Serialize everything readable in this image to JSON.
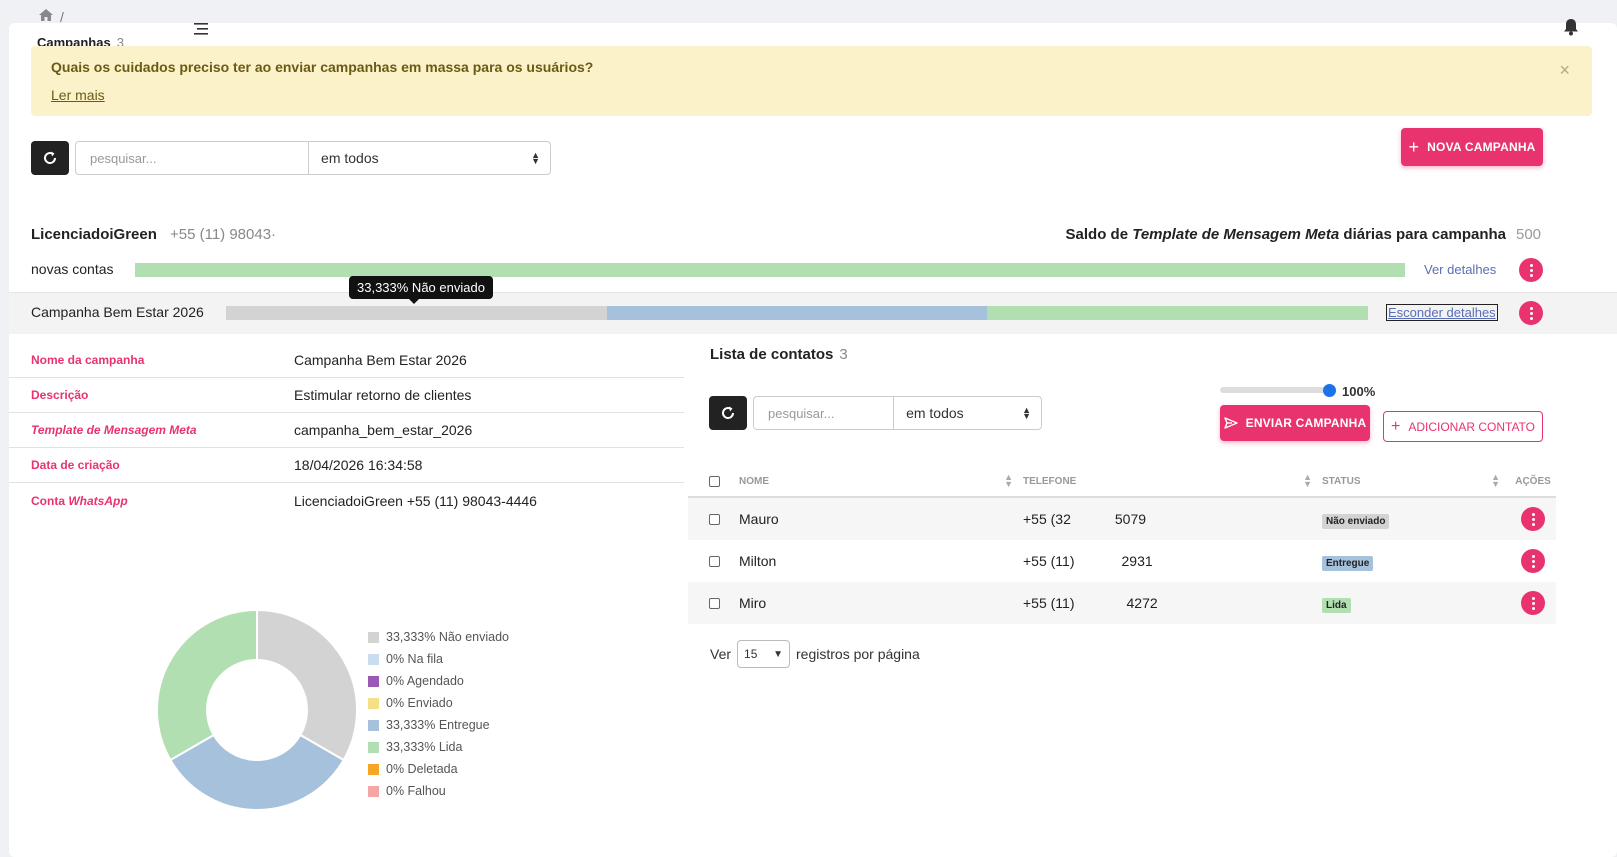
{
  "breadcrumb": {
    "separator": "/"
  },
  "page": {
    "title": "Campanhas",
    "count": "3"
  },
  "alert": {
    "question": "Quais os cuidados preciso ter ao enviar campanhas em massa para os usuários?",
    "link": "Ler mais",
    "close": "×"
  },
  "toolbar": {
    "search_placeholder": "pesquisar...",
    "filter_value": "em todos",
    "new_campaign": "NOVA CAMPANHA"
  },
  "account": {
    "name": "LicenciadoiGreen",
    "phone": "+55 (11) 98043·",
    "saldo_prefix": "Saldo de",
    "saldo_em": "Template de Mensagem Meta",
    "saldo_suffix": "diárias para campanha",
    "saldo_value": "500"
  },
  "groups": [
    {
      "label": "novas contas",
      "action": "Ver detalhes"
    },
    {
      "label": "Campanha Bem Estar 2026",
      "action": "Esconder detalhes",
      "tooltip": "33,333% Não enviado"
    }
  ],
  "details": [
    {
      "key": "Nome da campanha",
      "value": "Campanha Bem Estar 2026"
    },
    {
      "key": "Descrição",
      "value": "Estimular retorno de clientes"
    },
    {
      "key": "Template de Mensagem Meta",
      "value": "campanha_bem_estar_2026"
    },
    {
      "key": "Data de criação",
      "value": "18/04/2026 16:34:58"
    },
    {
      "key_prefix": "Conta",
      "key_em": "WhatsApp",
      "value": "LicenciadoiGreen +55 (11) 98043-4446"
    }
  ],
  "chart_data": {
    "type": "pie",
    "categories": [
      "Não enviado",
      "Na fila",
      "Agendado",
      "Enviado",
      "Entregue",
      "Lida",
      "Deletada",
      "Falhou"
    ],
    "values": [
      33.333,
      0,
      0,
      0,
      33.333,
      33.333,
      0,
      0
    ],
    "labels": [
      "33,333% Não enviado",
      "0% Na fila",
      "0% Agendado",
      "0% Enviado",
      "33,333% Entregue",
      "33,333% Lida",
      "0% Deletada",
      "0% Falhou"
    ],
    "colors": [
      "#d3d3d3",
      "#c9dcf0",
      "#9b59b6",
      "#f5e08a",
      "#a6c1dc",
      "#b1dfb1",
      "#f5a623",
      "#f4a6a6"
    ]
  },
  "contacts": {
    "title": "Lista de contatos",
    "count": "3",
    "search_placeholder": "pesquisar...",
    "filter_value": "em todos",
    "slider_value": "100%",
    "slider_fraction": 1.0,
    "send_button": "ENVIAR CAMPANHA",
    "add_button": "ADICIONAR CONTATO",
    "columns": [
      "NOME",
      "TELEFONE",
      "STATUS",
      "AÇÕES"
    ],
    "rows": [
      {
        "name": "Mauro",
        "phone_a": "+55 (32",
        "phone_b": "5079",
        "status": "Não enviado",
        "status_color": "#d3d3d3"
      },
      {
        "name": "Milton",
        "phone_a": "+55 (11)",
        "phone_b": "2931",
        "status": "Entregue",
        "status_color": "#a6c1dc"
      },
      {
        "name": "Miro",
        "phone_a": "+55 (11)",
        "phone_b": "4272",
        "status": "Lida",
        "status_color": "#b1dfb1"
      }
    ],
    "per_page_prefix": "Ver",
    "per_page_value": "15",
    "per_page_suffix": "registros por página"
  },
  "colors": {
    "accent": "#e8336e",
    "progress_green": "#b1dfb1",
    "progress_grey": "#d3d3d3",
    "progress_blue": "#a6c1dc"
  }
}
